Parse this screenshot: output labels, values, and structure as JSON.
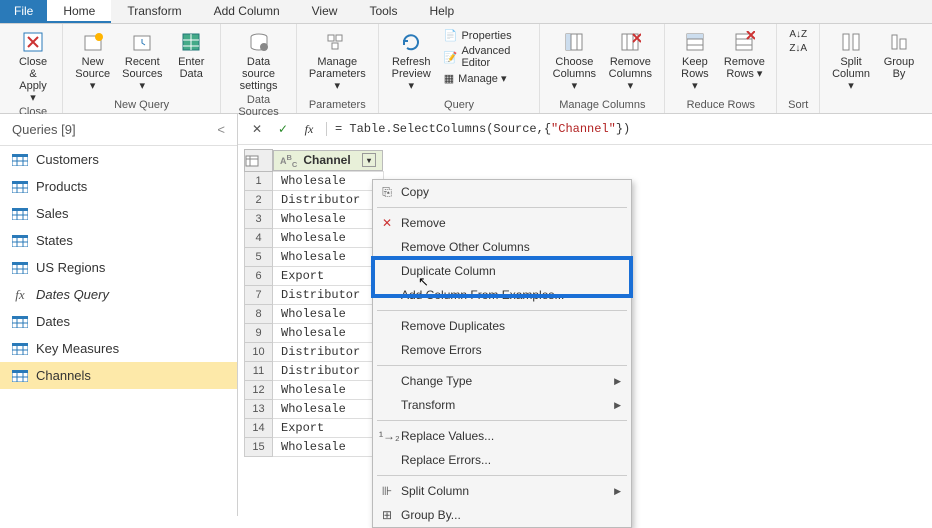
{
  "menu": {
    "file": "File",
    "items": [
      "Home",
      "Transform",
      "Add Column",
      "View",
      "Tools",
      "Help"
    ],
    "activeIndex": 0
  },
  "ribbon": {
    "close": {
      "label": "Close &\nApply ▾",
      "group": "Close"
    },
    "newq": {
      "new": "New\nSource ▾",
      "recent": "Recent\nSources ▾",
      "enter": "Enter\nData",
      "group": "New Query"
    },
    "ds": {
      "settings": "Data source\nsettings",
      "group": "Data Sources"
    },
    "params": {
      "manage": "Manage\nParameters ▾",
      "group": "Parameters"
    },
    "query": {
      "refresh": "Refresh\nPreview ▾",
      "props": "Properties",
      "adv": "Advanced Editor",
      "manage": "Manage ▾",
      "group": "Query"
    },
    "mc": {
      "choose": "Choose\nColumns ▾",
      "remove": "Remove\nColumns ▾",
      "group": "Manage Columns"
    },
    "rr": {
      "keep": "Keep\nRows ▾",
      "remove": "Remove\nRows ▾",
      "group": "Reduce Rows"
    },
    "sort": {
      "group": "Sort"
    },
    "split": {
      "label": "Split\nColumn ▾"
    },
    "groupby": {
      "label": "Group\nBy"
    }
  },
  "queries": {
    "title": "Queries [9]",
    "items": [
      {
        "name": "Customers",
        "type": "table"
      },
      {
        "name": "Products",
        "type": "table"
      },
      {
        "name": "Sales",
        "type": "table"
      },
      {
        "name": "States",
        "type": "table"
      },
      {
        "name": "US Regions",
        "type": "table"
      },
      {
        "name": "Dates Query",
        "type": "fx",
        "italic": true
      },
      {
        "name": "Dates",
        "type": "table"
      },
      {
        "name": "Key Measures",
        "type": "table"
      },
      {
        "name": "Channels",
        "type": "table",
        "selected": true
      }
    ]
  },
  "formula": {
    "prefix": "= Table.SelectColumns(Source,{",
    "quoted": "\"Channel\"",
    "suffix": "})"
  },
  "grid": {
    "column": {
      "name": "Channel",
      "typeIcon": "ABC"
    },
    "rows": [
      "Wholesale",
      "Distributor",
      "Wholesale",
      "Wholesale",
      "Wholesale",
      "Export",
      "Distributor",
      "Wholesale",
      "Wholesale",
      "Distributor",
      "Distributor",
      "Wholesale",
      "Wholesale",
      "Export",
      "Wholesale"
    ]
  },
  "contextMenu": [
    {
      "label": "Copy",
      "icon": "copy"
    },
    {
      "sep": true
    },
    {
      "label": "Remove",
      "icon": "x"
    },
    {
      "label": "Remove Other Columns"
    },
    {
      "label": "Duplicate Column"
    },
    {
      "label": "Add Column From Examples..."
    },
    {
      "sep": true
    },
    {
      "label": "Remove Duplicates"
    },
    {
      "label": "Remove Errors"
    },
    {
      "sep": true
    },
    {
      "label": "Change Type",
      "submenu": true
    },
    {
      "label": "Transform",
      "submenu": true
    },
    {
      "sep": true
    },
    {
      "label": "Replace Values...",
      "icon": "replace"
    },
    {
      "label": "Replace Errors..."
    },
    {
      "sep": true
    },
    {
      "label": "Split Column",
      "icon": "split",
      "submenu": true
    },
    {
      "label": "Group By...",
      "icon": "group"
    }
  ]
}
